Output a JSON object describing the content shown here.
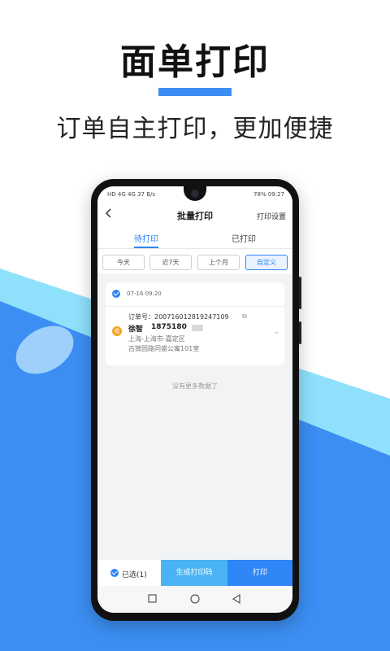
{
  "promo": {
    "title": "面单打印",
    "subtitle": "订单自主打印，更加便捷"
  },
  "colors": {
    "accent": "#2f86f6",
    "accent_light": "#4ab3f4",
    "bg_blue": "#3c8ef2",
    "bg_cyan": "#8fe0fb"
  },
  "status_bar": {
    "left": "HD 4G 4G 37 B/s",
    "right": "78% 09:27"
  },
  "nav": {
    "title": "批量打印",
    "right": "打印设置"
  },
  "tabs": [
    {
      "label": "待打印",
      "active": true
    },
    {
      "label": "已打印",
      "active": false
    }
  ],
  "filters": [
    {
      "label": "今天",
      "active": false
    },
    {
      "label": "近7天",
      "active": false
    },
    {
      "label": "上个月",
      "active": false
    },
    {
      "label": "自定义",
      "active": true
    }
  ],
  "order": {
    "date": "07-16 09:20",
    "order_label": "订单号：",
    "order_no": "200716012819247109",
    "avatar_char": "收",
    "name": "徐智",
    "phone": "1875180",
    "address_line1": "上海-上海市-嘉定区",
    "address_line2": "古猗园路同盛公寓101室"
  },
  "empty_hint": "没有更多数据了",
  "bottom": {
    "selected": "已选(1)",
    "generate": "生成打印码",
    "print": "打印"
  }
}
